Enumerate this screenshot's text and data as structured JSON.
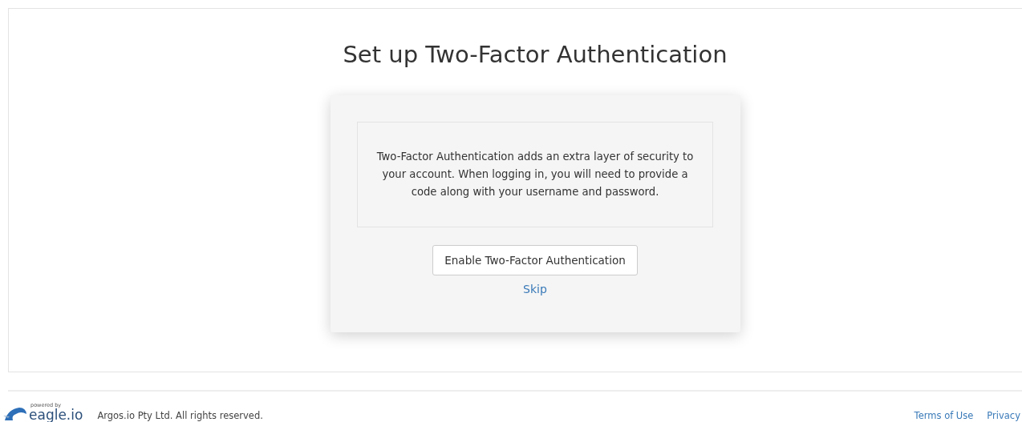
{
  "heading": "Set up Two-Factor Authentication",
  "card": {
    "description": "Two-Factor Authentication adds an extra layer of security to your account. When logging in, you will need to provide a code along with your username and password.",
    "enable_button": "Enable Two-Factor Authentication",
    "skip_link": "Skip"
  },
  "footer": {
    "logo_tagline": "powered by",
    "logo_name": "eagle.io",
    "copyright": "Argos.io Pty Ltd. All rights reserved.",
    "links": [
      "Terms of Use",
      "Privacy"
    ]
  }
}
